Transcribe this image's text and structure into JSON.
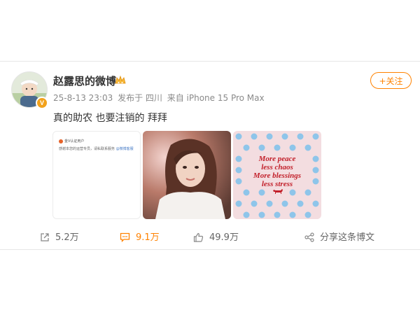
{
  "post": {
    "author": "赵露思的微博",
    "verified_badge": "V",
    "date": "25-8-13 23:03",
    "location": "发布于 四川",
    "device": "来自 iPhone 15 Pro Max",
    "follow_label": "+关注",
    "text": "真的助农 也要注销的 拜拜"
  },
  "images": {
    "notice_header": "金V认证用户",
    "notice_body": "感谢本您的运营专员，请私联系服务",
    "notice_link": "@微博客服",
    "poster_lines": [
      "More peace",
      "less chaos",
      "More blessings",
      "less stress"
    ]
  },
  "actions": {
    "repost": "5.2万",
    "comment": "9.1万",
    "like": "49.9万",
    "share": "分享这条博文"
  },
  "colors": {
    "accent": "#ff8200",
    "poster_red": "#c2202a",
    "poster_dot": "#8ec5ea",
    "poster_bg": "#f3dde0"
  }
}
